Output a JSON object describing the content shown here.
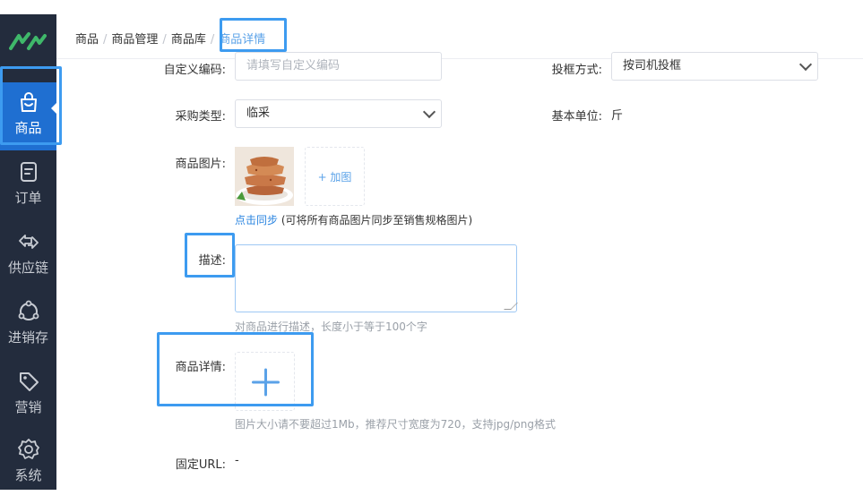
{
  "sidebar": {
    "items": [
      {
        "label": "商品",
        "icon": "shopping-bag-icon",
        "active": true
      },
      {
        "label": "订单",
        "icon": "order-document-icon",
        "active": false
      },
      {
        "label": "供应链",
        "icon": "supply-chain-arrows-icon",
        "active": false
      },
      {
        "label": "进销存",
        "icon": "inventory-cycle-icon",
        "active": false
      },
      {
        "label": "营销",
        "icon": "tag-icon",
        "active": false
      },
      {
        "label": "系统",
        "icon": "gear-icon",
        "active": false
      }
    ]
  },
  "breadcrumb": {
    "items": [
      "商品",
      "商品管理",
      "商品库"
    ],
    "separator": "/",
    "current": "商品详情"
  },
  "form": {
    "custom_code": {
      "label": "自定义编码:",
      "placeholder": "请填写自定义编码"
    },
    "basket_method": {
      "label": "投框方式:",
      "value": "按司机投框"
    },
    "purchase_type": {
      "label": "采购类型:",
      "value": "临采"
    },
    "base_unit": {
      "label": "基本单位:",
      "value": "斤"
    },
    "product_image": {
      "label": "商品图片:",
      "add_label": "+ 加图",
      "sync_link": "点击同步",
      "sync_note": " (可将所有商品图片同步至销售规格图片)"
    },
    "description": {
      "label": "描述:",
      "hint": "对商品进行描述，长度小于等于100个字"
    },
    "product_detail": {
      "label": "商品详情:",
      "hint": "图片大小请不要超过1Mb，推荐尺寸宽度为720，支持jpg/png格式"
    },
    "fixed_url": {
      "label": "固定URL:",
      "value": "-"
    }
  },
  "colors": {
    "sidebar_bg": "#232c3d",
    "active_bg": "#1f6fd1",
    "accent": "#2a84e0",
    "highlight_frame": "#3d9bf0"
  }
}
